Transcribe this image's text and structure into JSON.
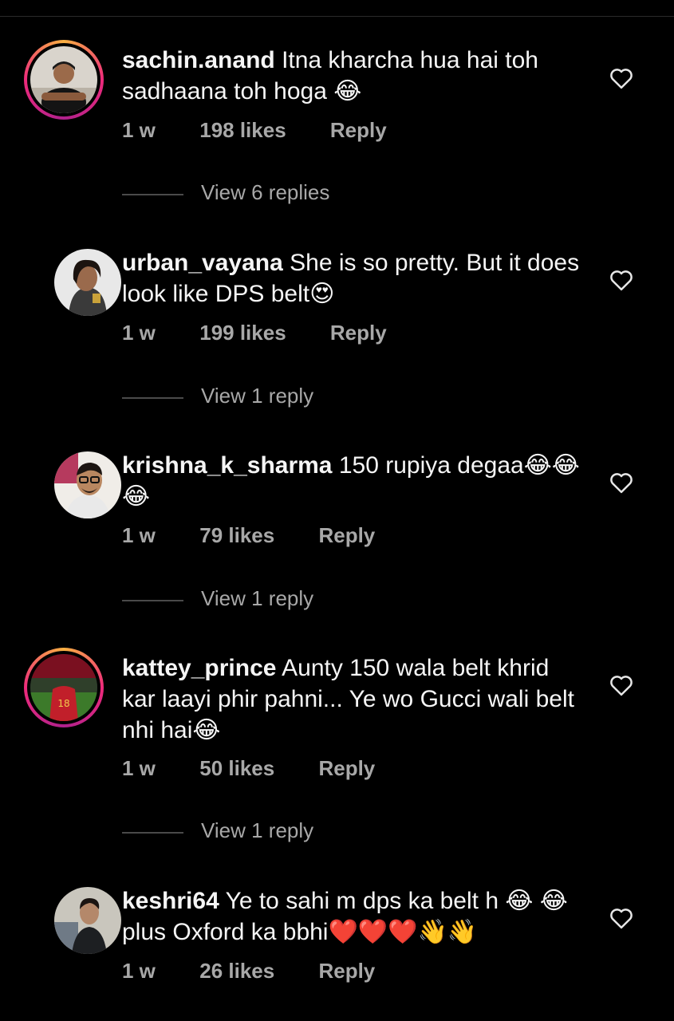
{
  "comments": [
    {
      "username": "sachin.anand",
      "text": "Itna kharcha hua hai toh sadhaana toh hoga 😂",
      "time": "1 w",
      "likes": "198 likes",
      "reply": "Reply",
      "view_replies": "View 6 replies",
      "story_ring": true
    },
    {
      "username": "urban_vayana",
      "text": "She is so pretty. But it does look like DPS belt😍",
      "time": "1 w",
      "likes": "199 likes",
      "reply": "Reply",
      "view_replies": "View 1 reply",
      "story_ring": false
    },
    {
      "username": "krishna_k_sharma",
      "text": "150 rupiya degaa😂😂😂",
      "time": "1 w",
      "likes": "79 likes",
      "reply": "Reply",
      "view_replies": "View 1 reply",
      "story_ring": false
    },
    {
      "username": "kattey_prince",
      "text": "Aunty 150 wala belt khrid kar laayi phir pahni... Ye wo Gucci wali belt nhi hai😂",
      "time": "1 w",
      "likes": "50 likes",
      "reply": "Reply",
      "view_replies": "View 1 reply",
      "story_ring": true
    },
    {
      "username": "keshri64",
      "text": "Ye to sahi m dps ka belt h 😂 😂 plus Oxford ka bbhi❤️❤️❤️👋👋",
      "time": "1 w",
      "likes": "26 likes",
      "reply": "Reply",
      "view_replies": "",
      "story_ring": false
    }
  ],
  "icons": {
    "like": "heart-outline-icon"
  },
  "colors": {
    "background": "#000000",
    "text": "#f5f5f5",
    "secondary": "#a8a8a8"
  }
}
